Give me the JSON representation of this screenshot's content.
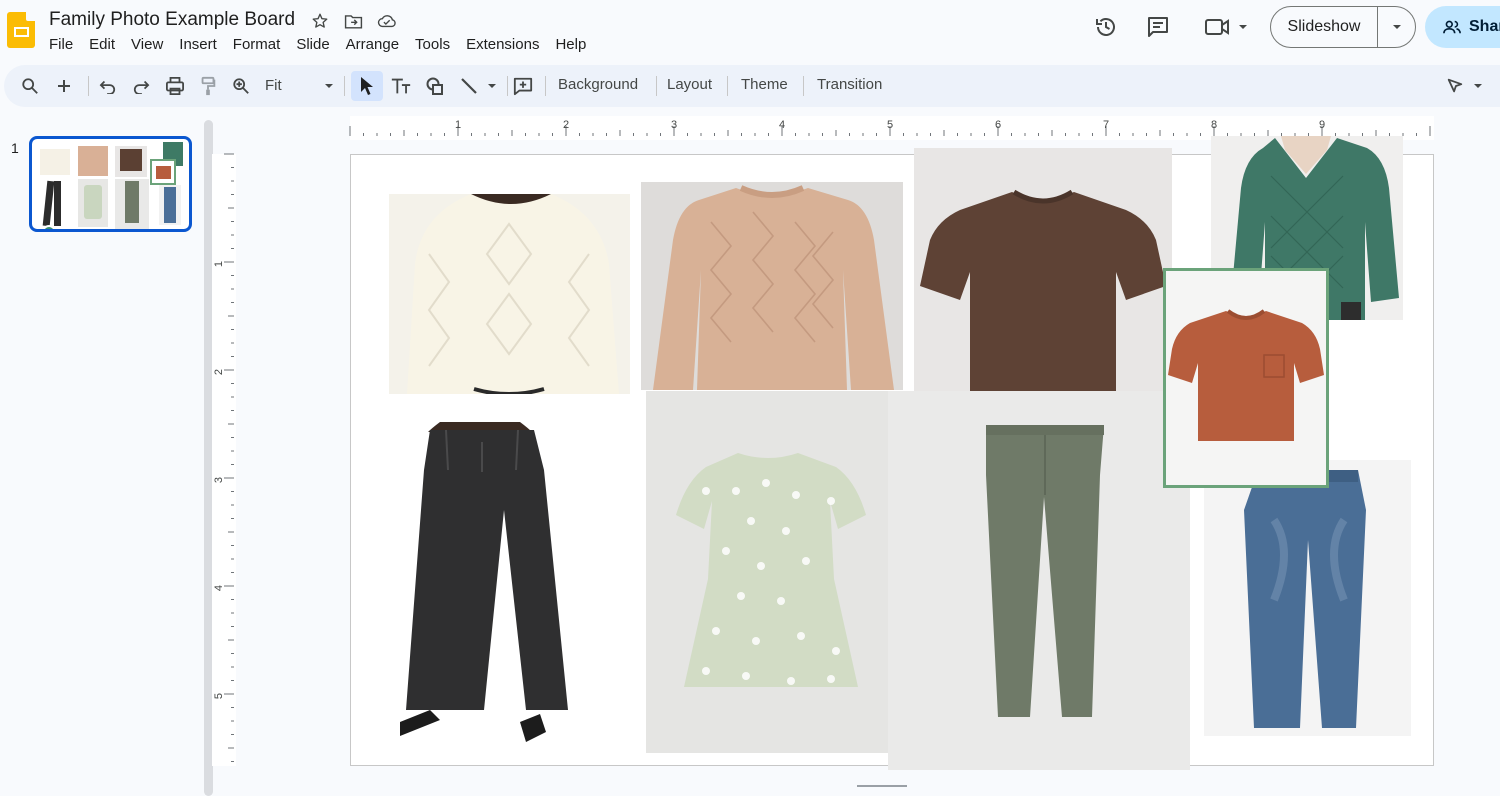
{
  "app": {
    "title": "Family Photo Example Board",
    "menu": [
      "File",
      "Edit",
      "View",
      "Insert",
      "Format",
      "Slide",
      "Arrange",
      "Tools",
      "Extensions",
      "Help"
    ]
  },
  "topbar": {
    "slideshow_label": "Slideshow",
    "share_label": "Shar"
  },
  "toolbar": {
    "zoom_label": "Fit",
    "background_label": "Background",
    "layout_label": "Layout",
    "theme_label": "Theme",
    "transition_label": "Transition"
  },
  "filmstrip": {
    "slide_number": "1"
  },
  "rulers": {
    "horizontal": [
      "1",
      "2",
      "3",
      "4",
      "5",
      "6",
      "7",
      "8",
      "9"
    ],
    "vertical": [
      "1",
      "2",
      "3",
      "4",
      "5"
    ]
  },
  "colors": {
    "brand_yellow": "#fbbc04",
    "selection_blue": "#0b57d0",
    "share_bg": "#c2e7ff",
    "toolbar_bg": "#edf2fa",
    "frame_green": "#6ba37a"
  },
  "slide_items": [
    "cream-sweater-image",
    "peach-knit-sweater-image",
    "brown-tshirt-image",
    "green-quilted-pullover-image",
    "rust-pocket-tshirt-image",
    "black-wide-leg-jeans-image",
    "sage-floral-dress-image",
    "olive-trousers-image",
    "blue-jeans-image"
  ]
}
